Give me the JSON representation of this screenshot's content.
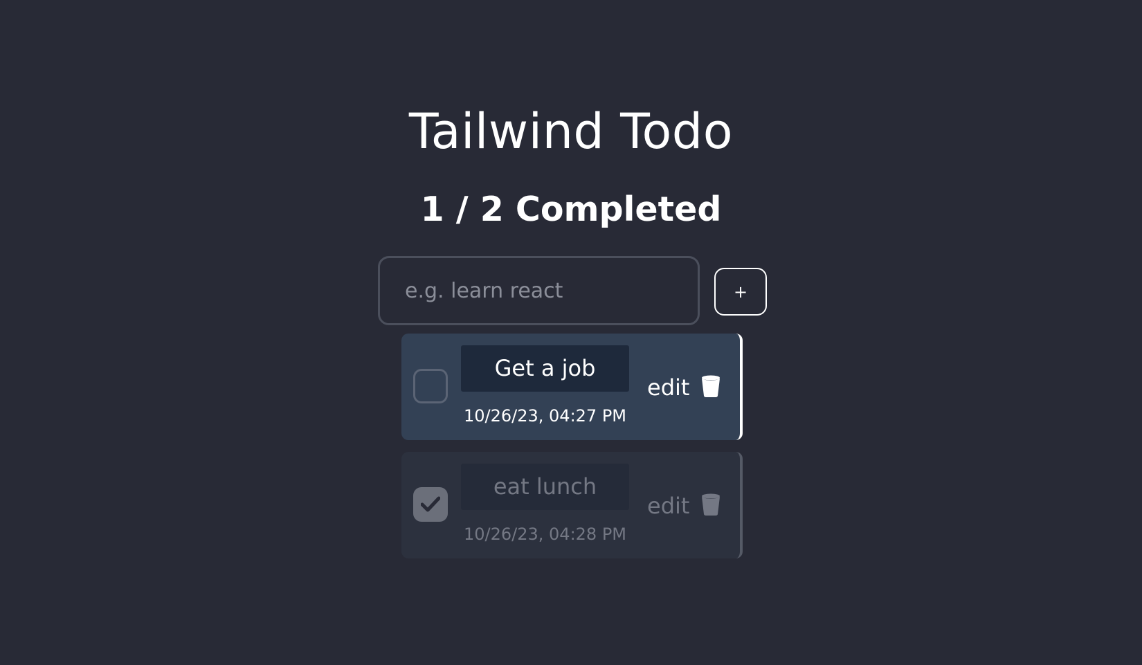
{
  "app": {
    "title": "Tailwind Todo",
    "progress_text": "1 / 2 Completed"
  },
  "new_todo": {
    "placeholder": "e.g. learn react",
    "value": "",
    "add_label": "+"
  },
  "todos": [
    {
      "text": "Get a job",
      "timestamp": "10/26/23, 04:27 PM",
      "completed": false,
      "edit_label": "edit",
      "delete_icon": "trash-icon"
    },
    {
      "text": "eat lunch",
      "timestamp": "10/26/23, 04:28 PM",
      "completed": true,
      "edit_label": "edit",
      "delete_icon": "trash-icon"
    }
  ],
  "colors": {
    "background": "#282a36",
    "active_card": "#334155",
    "done_card": "#2c313e",
    "text_box": "#1e293b",
    "muted_text": "#747884"
  }
}
